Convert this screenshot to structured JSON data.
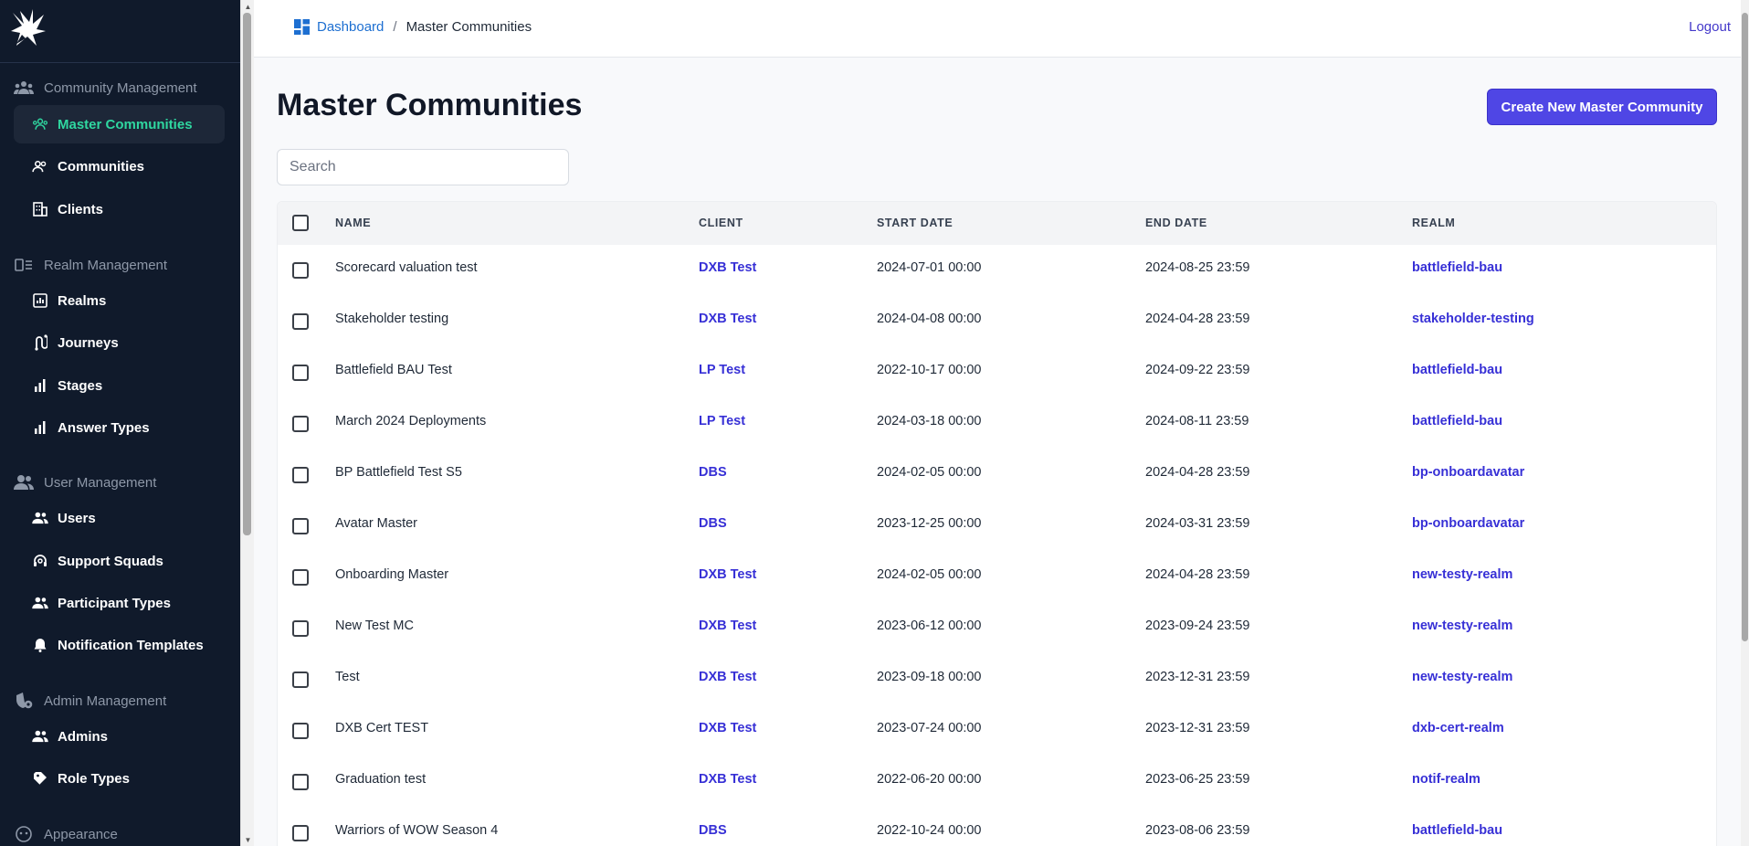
{
  "colors": {
    "sidebar_bg": "#101a2b",
    "accent": "#2fd7a0",
    "primary": "#4f46e5",
    "link": "#3730d6"
  },
  "sidebar": {
    "sections": [
      {
        "label": "Community Management",
        "icon": "community-icon",
        "items": [
          {
            "label": "Master Communities",
            "icon": "master-communities-icon",
            "active": true
          },
          {
            "label": "Communities",
            "icon": "communities-icon"
          },
          {
            "label": "Clients",
            "icon": "building-icon"
          }
        ]
      },
      {
        "label": "Realm Management",
        "icon": "realm-icon",
        "items": [
          {
            "label": "Realms",
            "icon": "chart-box-icon"
          },
          {
            "label": "Journeys",
            "icon": "route-icon"
          },
          {
            "label": "Stages",
            "icon": "bar-chart-icon"
          },
          {
            "label": "Answer Types",
            "icon": "bar-chart-icon"
          }
        ]
      },
      {
        "label": "User Management",
        "icon": "user-group-icon",
        "items": [
          {
            "label": "Users",
            "icon": "users-icon"
          },
          {
            "label": "Support Squads",
            "icon": "headset-icon"
          },
          {
            "label": "Participant Types",
            "icon": "participants-icon"
          },
          {
            "label": "Notification Templates",
            "icon": "bell-icon"
          }
        ]
      },
      {
        "label": "Admin Management",
        "icon": "admin-shield-icon",
        "items": [
          {
            "label": "Admins",
            "icon": "admins-icon"
          },
          {
            "label": "Role Types",
            "icon": "tag-icon"
          }
        ]
      },
      {
        "label": "Appearance",
        "icon": "smiley-icon",
        "items": []
      }
    ]
  },
  "header": {
    "breadcrumb_home": "Dashboard",
    "breadcrumb_sep": "/",
    "breadcrumb_current": "Master Communities",
    "logout": "Logout"
  },
  "main": {
    "title": "Master Communities",
    "create_button": "Create New Master Community",
    "search_placeholder": "Search"
  },
  "table": {
    "columns": [
      "NAME",
      "CLIENT",
      "START DATE",
      "END DATE",
      "REALM"
    ],
    "rows": [
      {
        "name": "Scorecard valuation test",
        "client": "DXB Test",
        "start": "2024-07-01 00:00",
        "end": "2024-08-25 23:59",
        "realm": "battlefield-bau"
      },
      {
        "name": "Stakeholder testing",
        "client": "DXB Test",
        "start": "2024-04-08 00:00",
        "end": "2024-04-28 23:59",
        "realm": "stakeholder-testing"
      },
      {
        "name": "Battlefield BAU Test",
        "client": "LP Test",
        "start": "2022-10-17 00:00",
        "end": "2024-09-22 23:59",
        "realm": "battlefield-bau"
      },
      {
        "name": "March 2024 Deployments",
        "client": "LP Test",
        "start": "2024-03-18 00:00",
        "end": "2024-08-11 23:59",
        "realm": "battlefield-bau"
      },
      {
        "name": "BP Battlefield Test S5",
        "client": "DBS",
        "start": "2024-02-05 00:00",
        "end": "2024-04-28 23:59",
        "realm": "bp-onboardavatar"
      },
      {
        "name": "Avatar Master",
        "client": "DBS",
        "start": "2023-12-25 00:00",
        "end": "2024-03-31 23:59",
        "realm": "bp-onboardavatar"
      },
      {
        "name": "Onboarding Master",
        "client": "DXB Test",
        "start": "2024-02-05 00:00",
        "end": "2024-04-28 23:59",
        "realm": "new-testy-realm"
      },
      {
        "name": "New Test MC",
        "client": "DXB Test",
        "start": "2023-06-12 00:00",
        "end": "2023-09-24 23:59",
        "realm": "new-testy-realm"
      },
      {
        "name": "Test",
        "client": "DXB Test",
        "start": "2023-09-18 00:00",
        "end": "2023-12-31 23:59",
        "realm": "new-testy-realm"
      },
      {
        "name": "DXB Cert TEST",
        "client": "DXB Test",
        "start": "2023-07-24 00:00",
        "end": "2023-12-31 23:59",
        "realm": "dxb-cert-realm"
      },
      {
        "name": "Graduation test",
        "client": "DXB Test",
        "start": "2022-06-20 00:00",
        "end": "2023-06-25 23:59",
        "realm": "notif-realm"
      },
      {
        "name": "Warriors of WOW Season 4",
        "client": "DBS",
        "start": "2022-10-24 00:00",
        "end": "2023-08-06 23:59",
        "realm": "battlefield-bau"
      }
    ]
  }
}
